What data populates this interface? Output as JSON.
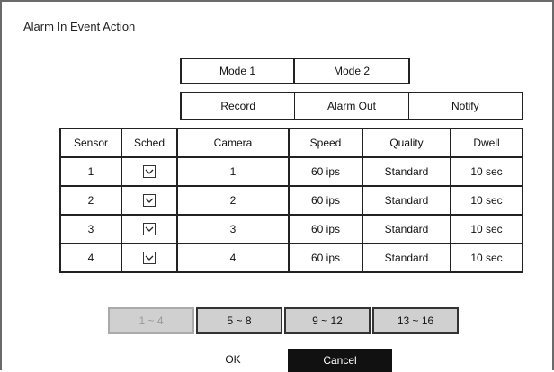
{
  "window": {
    "title": "Alarm In Event Action"
  },
  "modes": [
    {
      "label": "Mode 1"
    },
    {
      "label": "Mode 2"
    }
  ],
  "action_tabs": [
    {
      "label": "Record"
    },
    {
      "label": "Alarm Out"
    },
    {
      "label": "Notify"
    }
  ],
  "table": {
    "headers": [
      "Sensor",
      "Sched",
      "Camera",
      "Speed",
      "Quality",
      "Dwell"
    ],
    "rows": [
      {
        "sensor": "1",
        "sched_checked": true,
        "camera": "1",
        "speed": "60 ips",
        "quality": "Standard",
        "dwell": "10 sec"
      },
      {
        "sensor": "2",
        "sched_checked": true,
        "camera": "2",
        "speed": "60 ips",
        "quality": "Standard",
        "dwell": "10 sec"
      },
      {
        "sensor": "3",
        "sched_checked": true,
        "camera": "3",
        "speed": "60 ips",
        "quality": "Standard",
        "dwell": "10 sec"
      },
      {
        "sensor": "4",
        "sched_checked": true,
        "camera": "4",
        "speed": "60 ips",
        "quality": "Standard",
        "dwell": "10 sec"
      }
    ]
  },
  "pages": [
    {
      "label": "1 ~ 4",
      "disabled": true
    },
    {
      "label": "5 ~ 8",
      "disabled": false
    },
    {
      "label": "9 ~ 12",
      "disabled": false
    },
    {
      "label": "13 ~ 16",
      "disabled": false
    }
  ],
  "buttons": {
    "ok": "OK",
    "cancel": "Cancel"
  }
}
